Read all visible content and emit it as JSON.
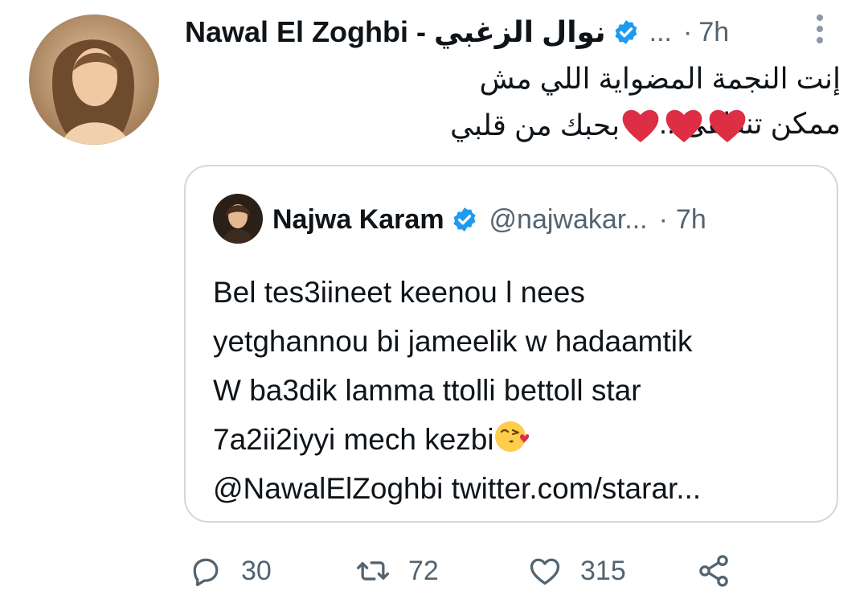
{
  "tweet": {
    "author_name": "Nawal El Zoghbi - نوال الزغبي",
    "ellipsis": "...",
    "separator": "·",
    "time": "7h",
    "text_line1": "إنت النجمة المضواية اللي مش ممكن تنطفى...",
    "text_line2": "بحبك من قلبي",
    "hearts": 3,
    "avatar_icon": "profile-photo",
    "verified_icon": "verified-badge-icon"
  },
  "quoted_tweet": {
    "author_name": "Najwa Karam",
    "handle": "@najwakar...",
    "separator": "·",
    "time": "7h",
    "lines": [
      "Bel tes3iineet keenou l nees",
      "yetghannou bi jameelik w hadaamtik",
      "W ba3dik lamma ttolli bettoll star",
      "7a2ii2iyyi mech kezbi",
      "@NawalElZoghbi twitter.com/starar..."
    ],
    "emoji": "face-blowing-a-kiss"
  },
  "actions": {
    "reply_count": "30",
    "retweet_count": "72",
    "like_count": "315",
    "share_icon": "share-icon"
  },
  "colors": {
    "text": "#0f1419",
    "muted": "#536471",
    "border": "#cfd9de",
    "verified": "#1d9bf0",
    "heart": "#dd2e44"
  }
}
